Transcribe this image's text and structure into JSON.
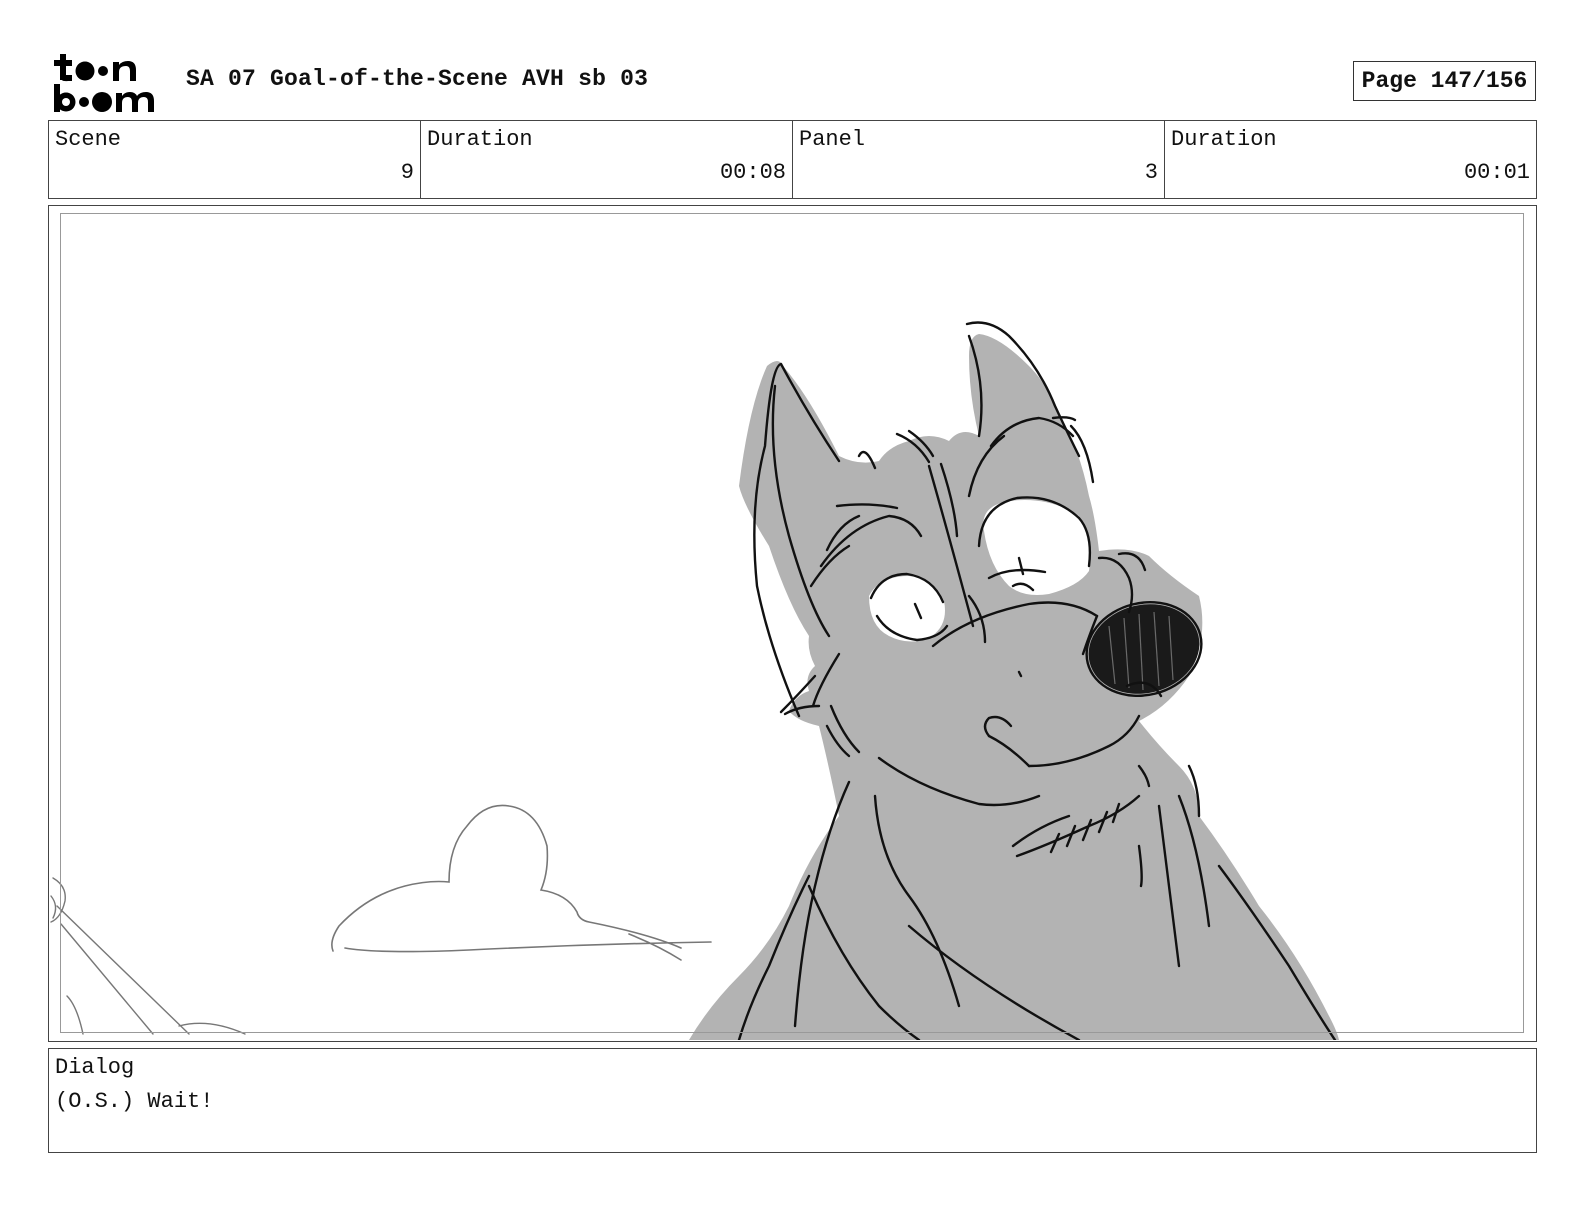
{
  "header": {
    "logo_icon": "toon-boom-logo",
    "title": "SA 07 Goal-of-the-Scene AVH sb 03",
    "page_label": "Page 147/156"
  },
  "info": {
    "scene_label": "Scene",
    "scene_value": "9",
    "scene_duration_label": "Duration",
    "scene_duration_value": "00:08",
    "panel_label": "Panel",
    "panel_value": "3",
    "panel_duration_label": "Duration",
    "panel_duration_value": "00:01"
  },
  "panel": {
    "art_icon": "storyboard-dog-sketch",
    "fill_color": "#b3b3b3",
    "line_color": "#111111"
  },
  "dialog": {
    "label": "Dialog",
    "text": "(O.S.) Wait!"
  }
}
